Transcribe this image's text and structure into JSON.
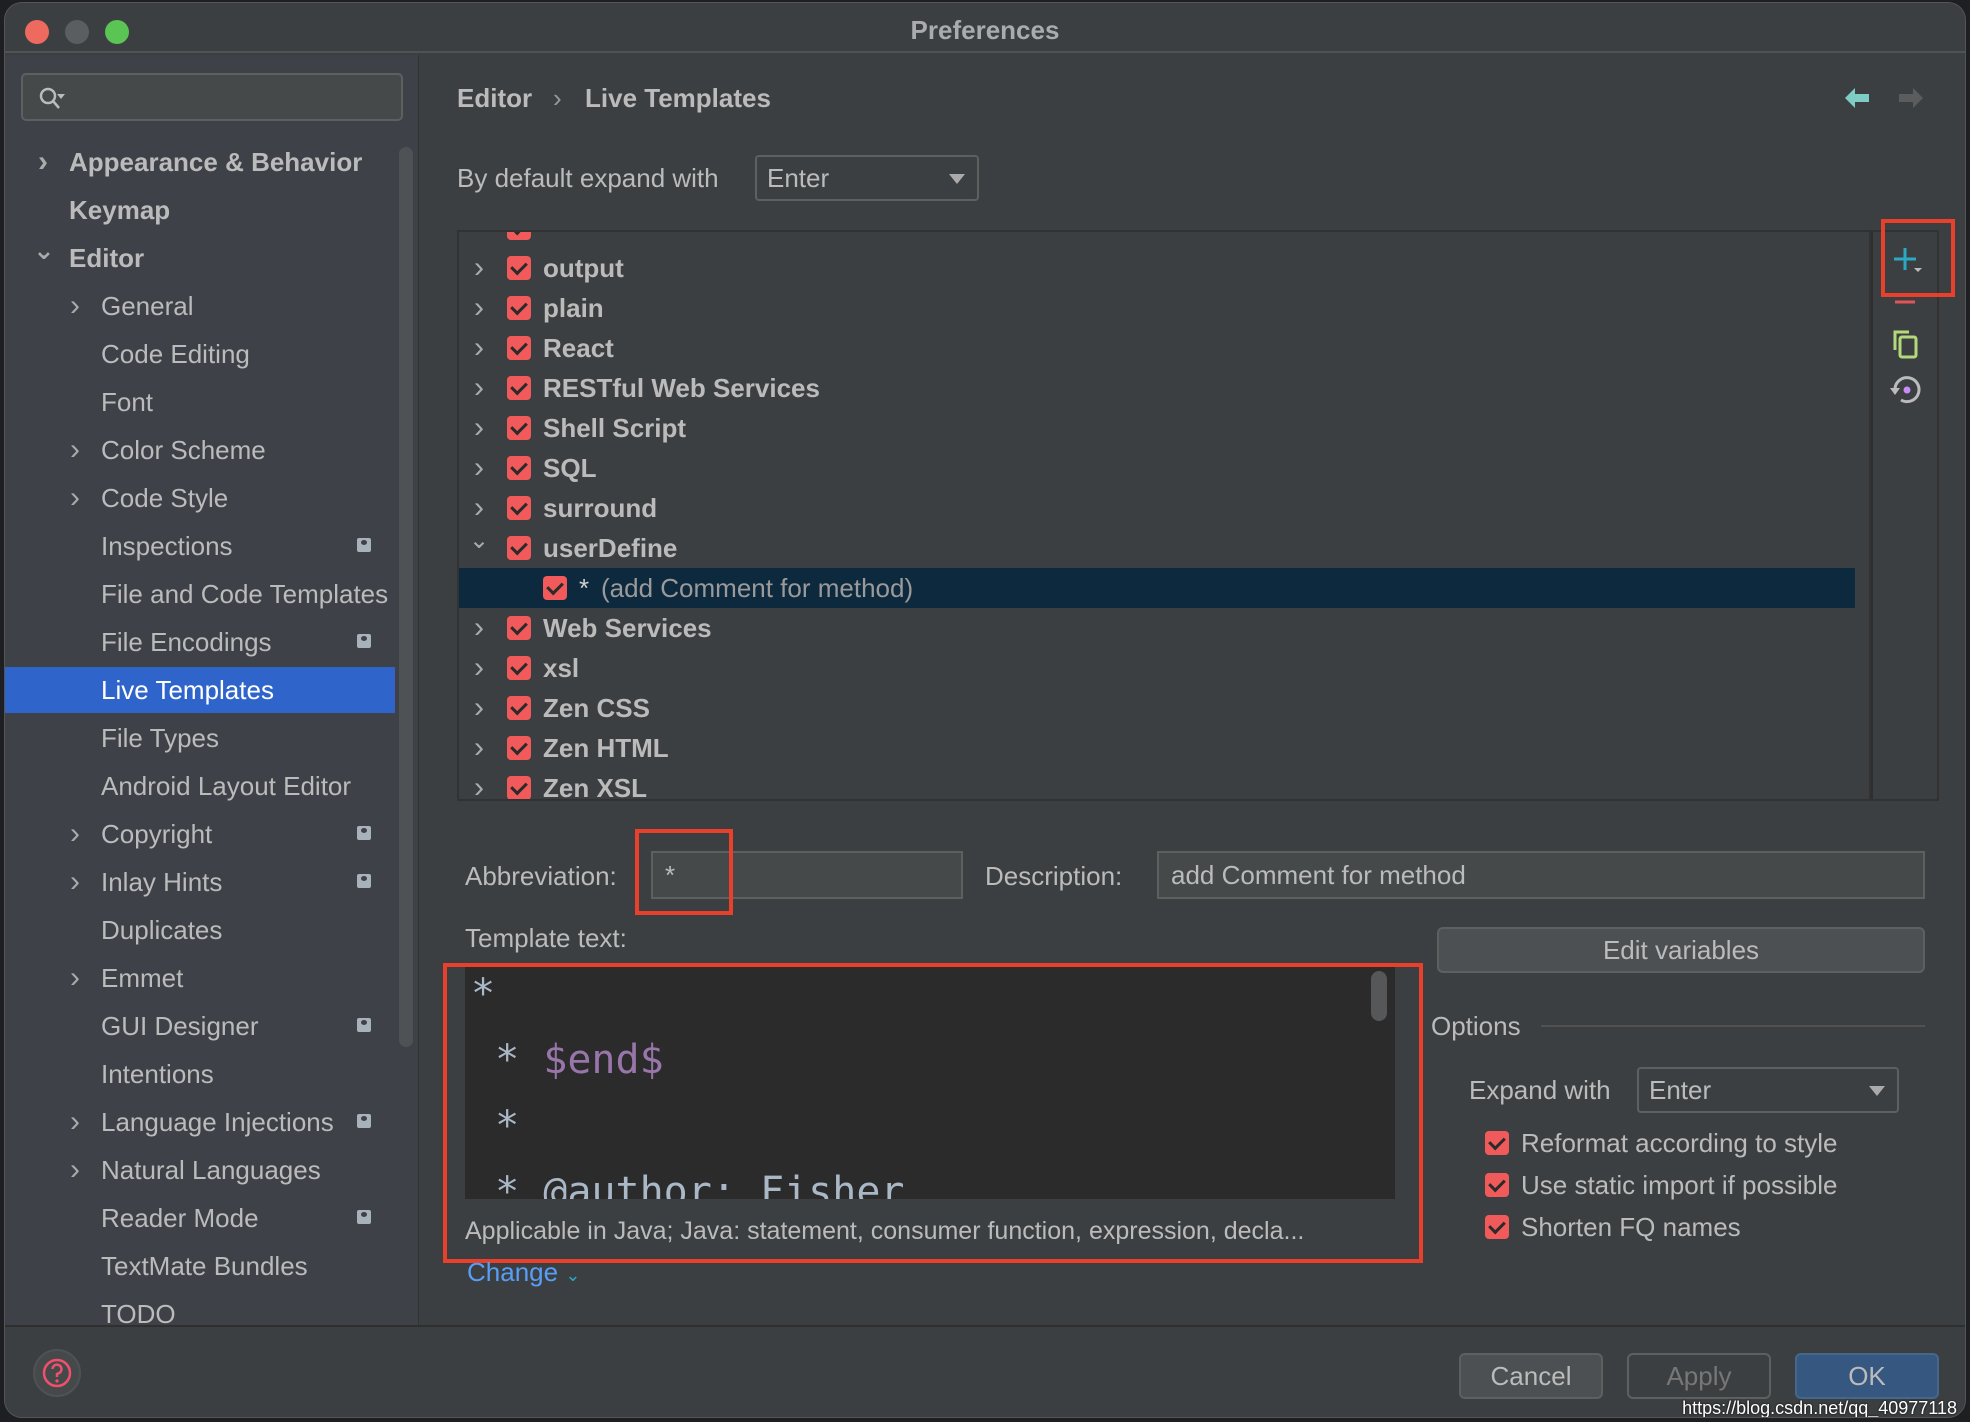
{
  "window": {
    "title": "Preferences"
  },
  "sidebar": {
    "search_placeholder": "",
    "items": [
      {
        "label": "Appearance & Behavior",
        "level": 0,
        "expandable": true,
        "expanded": false,
        "badge": false
      },
      {
        "label": "Keymap",
        "level": 0,
        "expandable": false,
        "badge": false
      },
      {
        "label": "Editor",
        "level": 0,
        "expandable": true,
        "expanded": true,
        "badge": false
      },
      {
        "label": "General",
        "level": 1,
        "expandable": true,
        "expanded": false,
        "badge": false
      },
      {
        "label": "Code Editing",
        "level": 1,
        "expandable": false,
        "badge": false
      },
      {
        "label": "Font",
        "level": 1,
        "expandable": false,
        "badge": false
      },
      {
        "label": "Color Scheme",
        "level": 1,
        "expandable": true,
        "expanded": false,
        "badge": false
      },
      {
        "label": "Code Style",
        "level": 1,
        "expandable": true,
        "expanded": false,
        "badge": false
      },
      {
        "label": "Inspections",
        "level": 1,
        "expandable": false,
        "badge": true
      },
      {
        "label": "File and Code Templates",
        "level": 1,
        "expandable": false,
        "badge": false
      },
      {
        "label": "File Encodings",
        "level": 1,
        "expandable": false,
        "badge": true
      },
      {
        "label": "Live Templates",
        "level": 1,
        "expandable": false,
        "badge": false,
        "selected": true
      },
      {
        "label": "File Types",
        "level": 1,
        "expandable": false,
        "badge": false
      },
      {
        "label": "Android Layout Editor",
        "level": 1,
        "expandable": false,
        "badge": false
      },
      {
        "label": "Copyright",
        "level": 1,
        "expandable": true,
        "expanded": false,
        "badge": true
      },
      {
        "label": "Inlay Hints",
        "level": 1,
        "expandable": true,
        "expanded": false,
        "badge": true
      },
      {
        "label": "Duplicates",
        "level": 1,
        "expandable": false,
        "badge": false
      },
      {
        "label": "Emmet",
        "level": 1,
        "expandable": true,
        "expanded": false,
        "badge": false
      },
      {
        "label": "GUI Designer",
        "level": 1,
        "expandable": false,
        "badge": true
      },
      {
        "label": "Intentions",
        "level": 1,
        "expandable": false,
        "badge": false
      },
      {
        "label": "Language Injections",
        "level": 1,
        "expandable": true,
        "expanded": false,
        "badge": true
      },
      {
        "label": "Natural Languages",
        "level": 1,
        "expandable": true,
        "expanded": false,
        "badge": false
      },
      {
        "label": "Reader Mode",
        "level": 1,
        "expandable": false,
        "badge": true
      },
      {
        "label": "TextMate Bundles",
        "level": 1,
        "expandable": false,
        "badge": false
      },
      {
        "label": "TODO",
        "level": 1,
        "expandable": false,
        "badge": false
      }
    ]
  },
  "breadcrumb": {
    "parent": "Editor",
    "separator": "›",
    "current": "Live Templates"
  },
  "expand_default": {
    "label": "By default expand with",
    "value": "Enter"
  },
  "template_groups": [
    {
      "name": "output",
      "checked": true,
      "expanded": false
    },
    {
      "name": "plain",
      "checked": true,
      "expanded": false
    },
    {
      "name": "React",
      "checked": true,
      "expanded": false
    },
    {
      "name": "RESTful Web Services",
      "checked": true,
      "expanded": false
    },
    {
      "name": "Shell Script",
      "checked": true,
      "expanded": false
    },
    {
      "name": "SQL",
      "checked": true,
      "expanded": false
    },
    {
      "name": "surround",
      "checked": true,
      "expanded": false
    },
    {
      "name": "userDefine",
      "checked": true,
      "expanded": true,
      "children": [
        {
          "abbreviation": "*",
          "description": "(add Comment for method)",
          "checked": true,
          "selected": true
        }
      ]
    },
    {
      "name": "Web Services",
      "checked": true,
      "expanded": false
    },
    {
      "name": "xsl",
      "checked": true,
      "expanded": false
    },
    {
      "name": "Zen CSS",
      "checked": true,
      "expanded": false
    },
    {
      "name": "Zen HTML",
      "checked": true,
      "expanded": false
    },
    {
      "name": "Zen XSL",
      "checked": true,
      "expanded": false
    }
  ],
  "toolbar": {
    "add": "plus-icon",
    "remove": "minus-icon",
    "copy": "copy-icon",
    "restore": "restore-icon"
  },
  "editor_form": {
    "abbreviation_label": "Abbreviation:",
    "abbreviation_value": "*",
    "description_label": "Description:",
    "description_value": "add Comment for method",
    "template_text_label": "Template text:",
    "template_lines": [
      {
        "prefix": "*",
        "var": ""
      },
      {
        "prefix": " * ",
        "var": "$end$"
      },
      {
        "prefix": " *",
        "var": ""
      },
      {
        "prefix": " * @author: Fisher",
        "var": ""
      }
    ],
    "applicable_text": "Applicable in Java; Java: statement, consumer function, expression, decla...",
    "change_link": "Change",
    "edit_variables": "Edit variables"
  },
  "options": {
    "title": "Options",
    "expand_with_label": "Expand with",
    "expand_with_value": "Enter",
    "checkboxes": [
      {
        "label": "Reformat according to style",
        "checked": true
      },
      {
        "label": "Use static import if possible",
        "checked": true
      },
      {
        "label": "Shorten FQ names",
        "checked": true
      }
    ]
  },
  "footer": {
    "cancel": "Cancel",
    "apply": "Apply",
    "ok": "OK",
    "help": "?",
    "watermark": "https://blog.csdn.net/qq_40977118"
  },
  "colors": {
    "accent_selection": "#2f65ca",
    "tree_selection": "#0d293e",
    "checkbox": "#f05a5a",
    "highlight_box": "#e8402b",
    "ok_button": "#365880",
    "template_variable": "#9876aa",
    "add_icon": "#2aa8c4",
    "remove_icon": "#e05555",
    "copy_icon": "#b3d97a",
    "link": "#589df6"
  }
}
